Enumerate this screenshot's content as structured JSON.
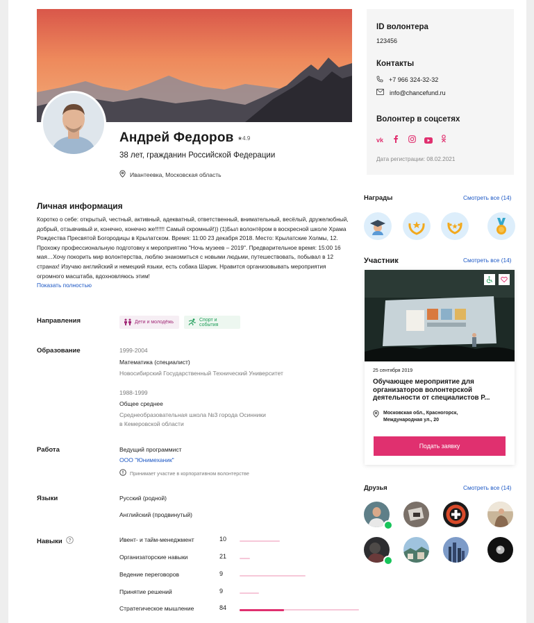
{
  "profile": {
    "name": "Андрей Федоров",
    "rating": "4.9",
    "subtitle": "38 лет, гражданин Российской Федерации",
    "location": "Ивантеевка, Московская область"
  },
  "personal": {
    "title": "Личная информация",
    "about": "Коротко о себе: открытый, честный, активный, адекватный, ответственный, внимательный, весёлый, дружелюбный, добрый, отзывчивый и, конечно, конечно же!!!!!! Самый скромный!)) (1)Был волонтёром в воскресной школе Храма Рождества Пресвятой Богородицы в Крылатском. Время: 11:00 23 декабря 2018. Место: Крылатские Холмы, 12. Прохожу профессиональную подготовку к мероприятию \"Ночь музеев – 2019\". Предварительное время: 15:00 16 мая…Хочу покорить мир волонтерства, люблю знакомиться с новыми людьми, путешествовать, побывал в 12 странах! Изучаю английский и немецкий языки, есть собака Шарик. Нравится организовывать мероприятия огромного масштаба, вдохновляюсь этим!",
    "show_more": "Показать полностью"
  },
  "directions": {
    "label": "Направления",
    "tags": [
      "Дети и молодёжь",
      "Спорт и события"
    ]
  },
  "education": {
    "label": "Образование",
    "items": [
      {
        "years": "1999-2004",
        "degree": "Математика (специалист)",
        "school": "Новосибирский Государственный Технический Университет"
      },
      {
        "years": "1988-1999",
        "degree": "Общее среднее",
        "school_line1": "Среднеобразовательная школа №3 города Осинники",
        "school_line2": "в Кемеровской области"
      }
    ]
  },
  "work": {
    "label": "Работа",
    "position": "Ведущий программист",
    "company": "ООО \"Юнимеханик\"",
    "note": "Принимает участие в корпоративном волонтерстве"
  },
  "languages": {
    "label": "Языки",
    "items": [
      "Русский (родной)",
      "Английский (продвинутый)"
    ]
  },
  "skills": {
    "label": "Навыки",
    "items": [
      {
        "name": "Ивент- и тайм-менеджмент",
        "value": "10",
        "track_fraction": 0.34,
        "fill_fraction": 0
      },
      {
        "name": "Организаторские навыки",
        "value": "21",
        "track_fraction": 0.09,
        "fill_fraction": 0
      },
      {
        "name": "Ведение переговоров",
        "value": "9",
        "track_fraction": 0.55,
        "fill_fraction": 0
      },
      {
        "name": "Принятие решений",
        "value": "9",
        "track_fraction": 0.16,
        "fill_fraction": 0
      },
      {
        "name": "Стратегическое мышление",
        "value": "84",
        "track_fraction": 1.0,
        "fill_fraction": 0.37
      }
    ]
  },
  "info_card": {
    "id_title": "ID волонтера",
    "id_value": "123456",
    "contacts_title": "Контакты",
    "phone": "+7 966 324-32-32",
    "email": "info@chancefund.ru",
    "social_title": "Волонтер в соцсетях",
    "social_icons": [
      "vk-icon",
      "facebook-icon",
      "instagram-icon",
      "youtube-icon",
      "odnoklassniki-icon"
    ],
    "registered": "Дата регистрации: 08.02.2021"
  },
  "awards": {
    "title": "Награды",
    "see_all": "Смотреть все (14)",
    "icons": [
      "graduate-award-icon",
      "stars-laurel-award-icon",
      "laurel-award-icon",
      "medal-award-icon"
    ]
  },
  "participant": {
    "title": "Участник",
    "see_all": "Смотреть все (14)",
    "event": {
      "date": "25 сентября 2019",
      "title": "Обучающее мероприятие для организаторов волонтерской деятельности от специалистов Р...",
      "location_line1": "Московская обл., Красногорск,",
      "location_line2": "Международная ул., 20",
      "apply": "Подать заявку"
    }
  },
  "friends": {
    "title": "Друзья",
    "see_all": "Смотреть все (14)"
  },
  "colors": {
    "accent": "#e0306f",
    "link": "#1a56c4",
    "online": "#17c45a"
  }
}
